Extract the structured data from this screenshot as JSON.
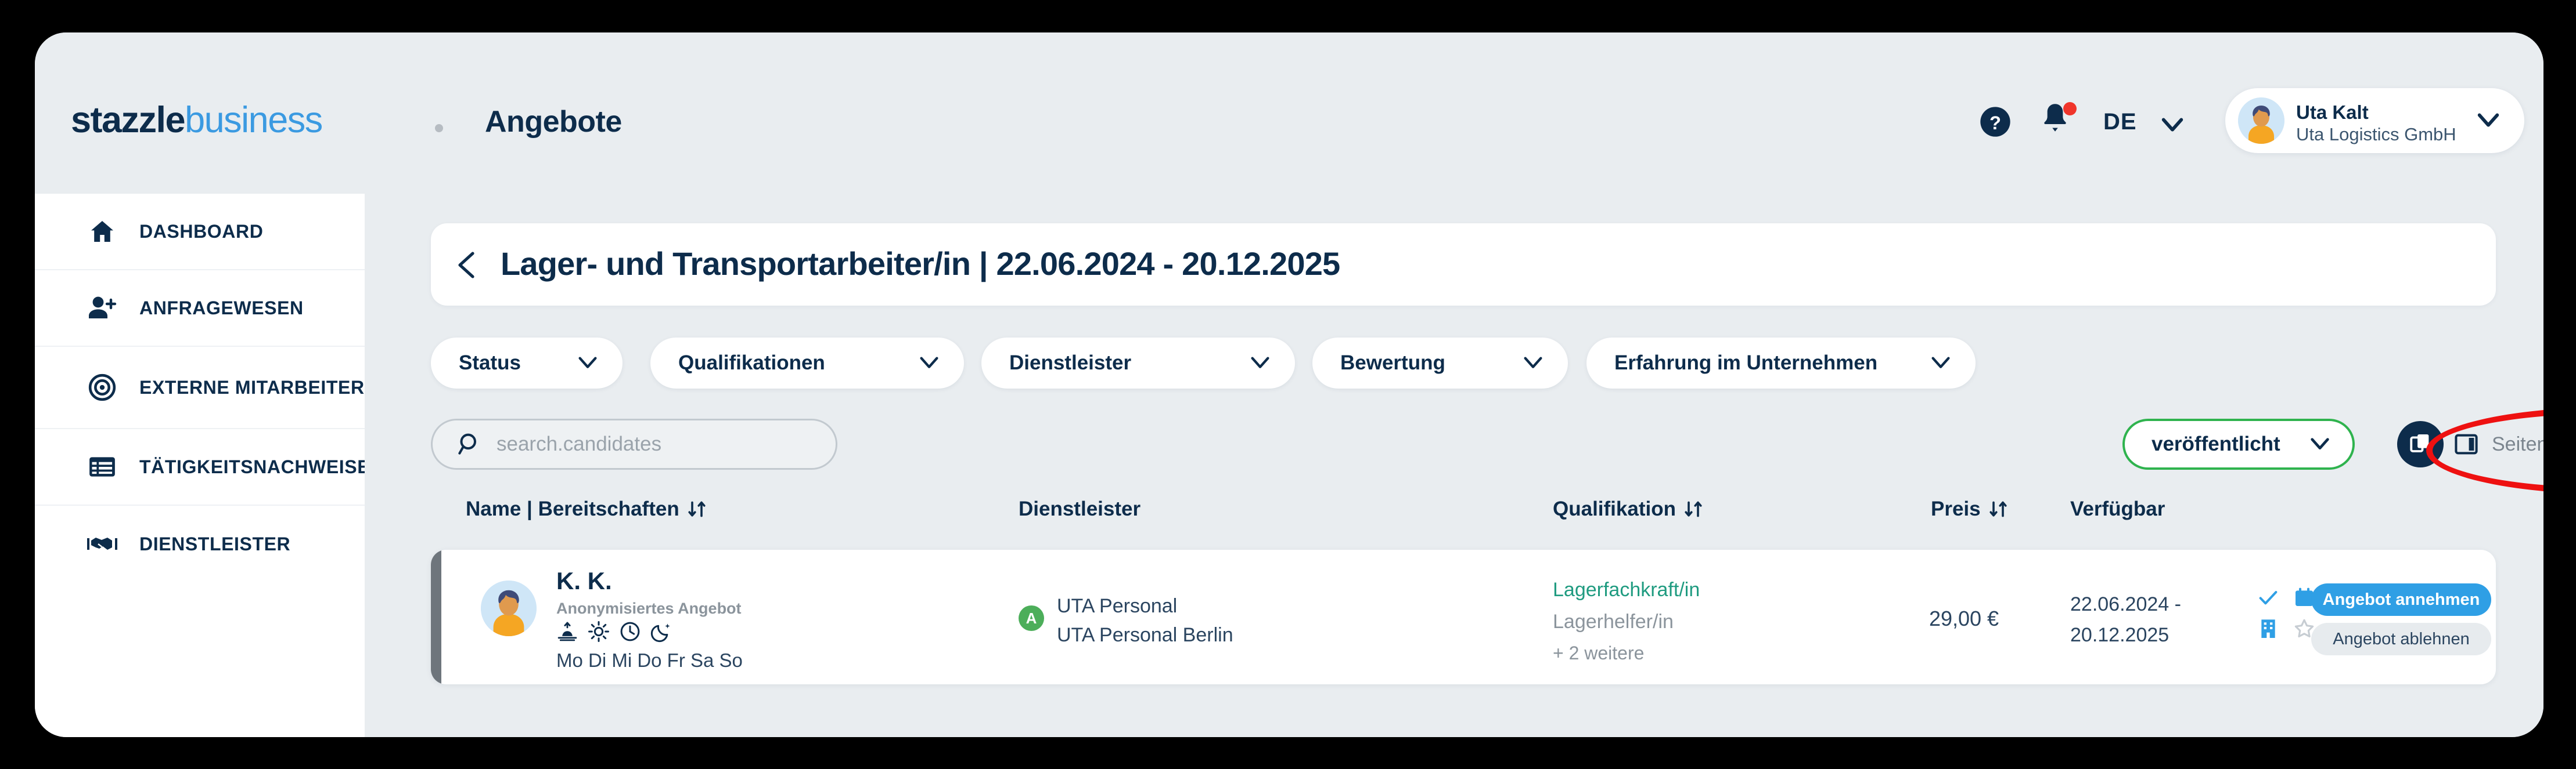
{
  "brand": {
    "logo_part1": "stazzle",
    "logo_part2": "business",
    "page_name": "Angebote"
  },
  "topbar": {
    "help_icon": "help-circle-icon",
    "bell_icon": "notification-bell-icon",
    "language": "DE",
    "language_chevron": "chevron-down-icon",
    "user": {
      "name": "Uta Kalt",
      "company": "Uta Logistics GmbH",
      "avatar": "user-avatar",
      "chevron": "chevron-down-icon"
    }
  },
  "sidebar": {
    "items": [
      {
        "label": "DASHBOARD",
        "icon": "home-icon"
      },
      {
        "label": "ANFRAGEWESEN",
        "icon": "person-add-icon"
      },
      {
        "label": "EXTERNE MITARBEITER",
        "icon": "target-icon"
      },
      {
        "label": "TÄTIGKEITSNACHWEISE",
        "icon": "list-table-icon"
      },
      {
        "label": "DIENSTLEISTER",
        "icon": "handshake-icon"
      }
    ]
  },
  "main": {
    "back_icon": "chevron-left-icon",
    "title": "Lager- und Transportarbeiter/in | 22.06.2024 - 20.12.2025",
    "filters": [
      {
        "label": "Status",
        "chevron": "chevron-down-icon"
      },
      {
        "label": "Qualifikationen",
        "chevron": "chevron-down-icon"
      },
      {
        "label": "Dienstleister",
        "chevron": "chevron-down-icon"
      },
      {
        "label": "Bewertung",
        "chevron": "chevron-down-icon"
      },
      {
        "label": "Erfahrung im Unternehmen",
        "chevron": "chevron-down-icon"
      }
    ],
    "search": {
      "placeholder": "search.candidates",
      "value": "",
      "icon": "search-icon"
    },
    "publish_status": {
      "label": "veröffentlicht",
      "chevron": "chevron-down-icon",
      "border_color": "#2fb34e"
    },
    "copy_button": {
      "icon": "copy-icon"
    },
    "sidebar_toggle": {
      "label": "Seitenleiste anzeigen",
      "icon": "panel-right-icon"
    },
    "annotation": {
      "shape": "red-ellipse",
      "color": "#ee1111"
    },
    "table": {
      "headers": [
        {
          "label": "Name | Bereitschaften",
          "sortable": true,
          "sort_icon": "sort-updown-icon"
        },
        {
          "label": "Dienstleister",
          "sortable": false
        },
        {
          "label": "Qualifikation",
          "sortable": true,
          "sort_icon": "sort-updown-icon"
        },
        {
          "label": "Preis",
          "sortable": true,
          "sort_icon": "sort-updown-icon"
        },
        {
          "label": "Verfügbar",
          "sortable": false
        }
      ],
      "rows": [
        {
          "name": "K. K.",
          "subtitle": "Anonymisiertes Angebot",
          "shift_icons": [
            "sunrise-icon",
            "sun-icon",
            "clock-icon",
            "moon-icon"
          ],
          "days": "Mo Di Mi Do Fr Sa So",
          "provider_badge": "A",
          "provider_line1": "UTA Personal",
          "provider_line2": "UTA Personal Berlin",
          "qualification_primary": "Lagerfachkraft/in",
          "qualification_secondary": "Lagerhelfer/in",
          "qualification_more": "+ 2 weitere",
          "price": "29,00 €",
          "available_from": "22.06.2024 -",
          "available_to": "20.12.2025",
          "status_icons": [
            "check-icon",
            "calendar-icon",
            "comment-off-icon",
            "building-icon",
            "star-outline-icon"
          ],
          "accept_label": "Angebot annehmen",
          "decline_label": "Angebot ablehnen"
        }
      ]
    }
  },
  "colors": {
    "navy": "#0d2c4b",
    "brand_blue": "#3b9ae1",
    "accent_blue": "#2f9fe5",
    "green": "#2fb34e",
    "teal": "#1f9b80",
    "red": "#ee1111",
    "page_bg": "#e9edf0"
  }
}
